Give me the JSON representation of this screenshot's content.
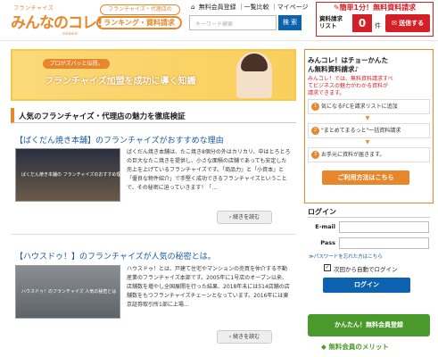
{
  "header": {
    "logo_small": "フランチャイズ",
    "logo_main": "みんなのコレ!",
    "logo_sub": "minkore!",
    "badge_top": "フランチャイズ・代理店の",
    "badge_main": "ランキング・資料請求",
    "top_links": [
      "無料会員登録",
      "一覧比較",
      "マイページ"
    ],
    "search_placeholder": "キーワード検索",
    "search_button": "検 索",
    "request_title": "簡単1分！無料資料請求",
    "request_label_1": "資料請求",
    "request_label_2": "リスト",
    "request_count": "0",
    "request_unit": "件",
    "request_send": "送信する"
  },
  "banner": {
    "tag": "プロがズバッと伝授。",
    "text": "フランチャイズ加盟を成功に導く知識"
  },
  "section": {
    "heading": "人気のフランチャイズ・代理店の魅力を徹底検証"
  },
  "articles": [
    {
      "title": "【ばくだん焼き本舗】のフランチャイズがおすすめな理由",
      "image_caption": "ばくだん焼き本舗の フランチャイズのおすすめ理由",
      "text": "ばくだん焼き本舗は、たこ焼き8個分の外はカリカリ、中はとろとろの巨大なたこ焼きを提供し、小さな面積の店舗であっても安定した売上を上げているフランチャイズです。「商品力」と「小資本」と「優良な物件紹介」で手堅く成功できるフランチャイズということで、その秘密に迫っていきます！「...",
      "more": "› 続きを読む"
    },
    {
      "title": "【ハウスドゥ！】のフランチャイズが人気の秘密とは。",
      "image_caption": "ハウスドゥ！のフランチャイズ 人気の秘密とは",
      "text": "ハウスドゥ！とは、戸建て住宅やマンションの売買を仲介する不動産業のフランチャイズ本部です。2005年に1号店のオープン以来、店舗数を増やし全国展開を行った結果、2018年末には514店舗の店舗数をもつフランチャイズチェーンとなっています。2016年には東京証券取引所1部に上場...",
      "more": "› 続きを読む"
    }
  ],
  "sidebar": {
    "head_1": "みんコレ！はチョーかんた",
    "head_2": "ん無料資料請求♪",
    "note_1": "みんコレ！では、無料資料請求すべ",
    "note_2": "てビジネスの魅力がわかる資料が",
    "note_3": "請求できます。",
    "steps": [
      {
        "num": "1",
        "label": "気になるFCを請求リストに追加"
      },
      {
        "num": "2",
        "label": "\"まとめてまるっと\"一括資料請求"
      },
      {
        "num": "3",
        "label": "お手元に資料が届きます。"
      }
    ],
    "howto": "ご利用方法はこちら",
    "login_title": "ログイン",
    "email_label": "E-mail",
    "pass_label": "Pass",
    "forgot": "≫パスワードを忘れた方はこちら",
    "auto_login": "次回から自動でログイン",
    "login_button": "ログイン",
    "register_button": "かんたん！無料会員登録",
    "merit": "無料会員のメリット"
  },
  "colors": {
    "brand_orange": "#e8862b",
    "red": "#d32027",
    "blue": "#0d62b0",
    "green": "#4a9a2b",
    "link": "#1a5aa8"
  }
}
